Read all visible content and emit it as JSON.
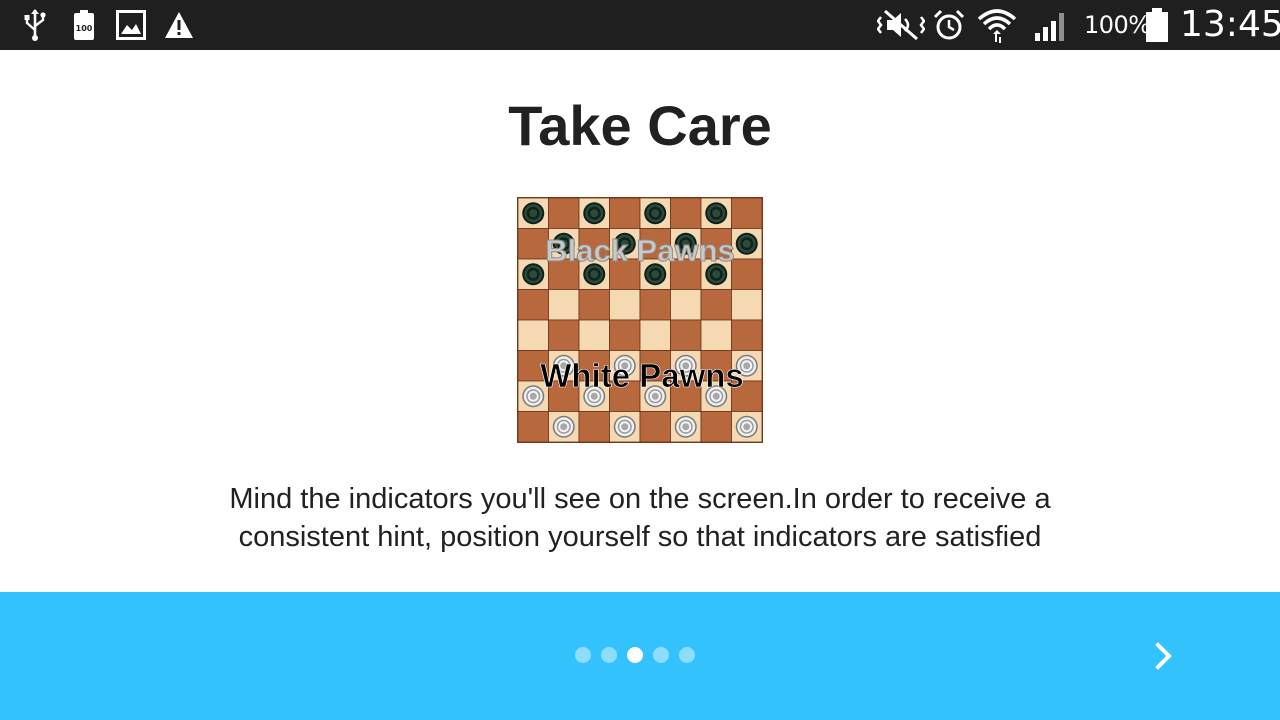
{
  "status_bar": {
    "battery_percent": "100%",
    "time": "13:45",
    "left_icons": [
      "usb-icon",
      "battery-saver-icon",
      "gallery-icon",
      "warning-icon"
    ],
    "right_icons": [
      "mute-icon",
      "alarm-icon",
      "wifi-icon",
      "signal-icon",
      "battery-icon"
    ]
  },
  "page": {
    "title": "Take Care",
    "board_labels": {
      "top": "Black Pawns",
      "bottom": "White Pawns"
    },
    "description": "Mind the indicators you'll see on the screen.In order to receive a consistent hint, position yourself so that indicators are satisfied"
  },
  "pager": {
    "total_pages": 5,
    "current_page": 3
  },
  "colors": {
    "status_bar": "#1f1f1f",
    "bottom_bar": "#33c2fd",
    "text": "#212121",
    "dark_square": "#b8683d",
    "light_square": "#f4d9b2"
  }
}
